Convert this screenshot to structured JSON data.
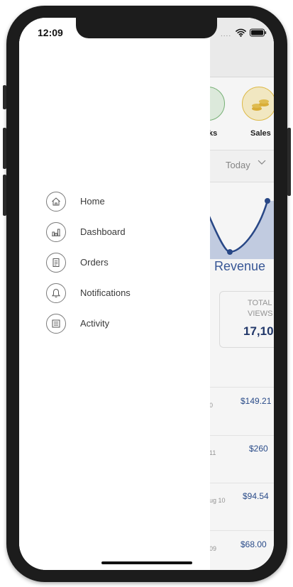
{
  "status_bar": {
    "time": "12:09",
    "signal_dots": "....",
    "wifi_icon": "wifi-icon",
    "battery_icon": "battery-icon"
  },
  "drawer": {
    "items": [
      {
        "label": "Home",
        "icon": "home-icon"
      },
      {
        "label": "Dashboard",
        "icon": "bar-chart-icon"
      },
      {
        "label": "Orders",
        "icon": "receipt-icon"
      },
      {
        "label": "Notifications",
        "icon": "bell-icon"
      },
      {
        "label": "Activity",
        "icon": "list-icon"
      }
    ]
  },
  "background": {
    "categories": [
      {
        "label": "ks",
        "icon": "green-book-icon"
      },
      {
        "label": "Sales",
        "icon": "gold-coins-icon"
      }
    ],
    "filter": {
      "value": "Today"
    },
    "chart_label": "Revenue",
    "stat_card": {
      "title_line1": "TOTAL",
      "title_line2": "VIEWS",
      "value": "17,10"
    },
    "transactions": [
      {
        "date_fragment": "0",
        "amount": "$149.21"
      },
      {
        "date_fragment": "11",
        "amount": "$260"
      },
      {
        "date_fragment": "ug 10",
        "amount": "$94.54"
      },
      {
        "date_fragment": "09",
        "amount": "$68.00"
      }
    ]
  },
  "colors": {
    "accent": "#2c4f8f",
    "chart_fill": "#c9d4ea",
    "chart_line": "#2a4a8c"
  }
}
